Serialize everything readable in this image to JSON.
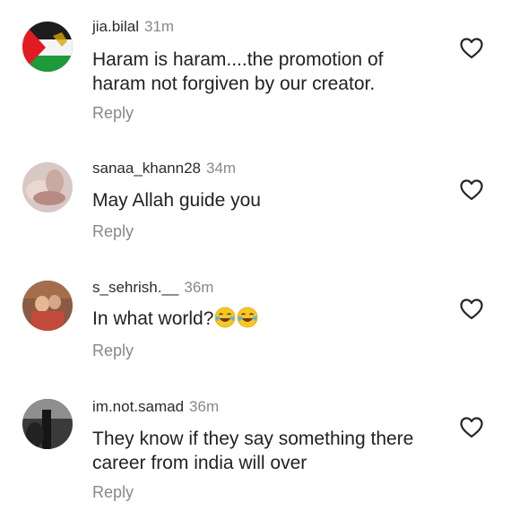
{
  "comments": [
    {
      "username": "jia.bilal",
      "time": "31m",
      "text_lines": [
        "Haram is haram....the promotion of",
        "haram not forgiven by our creator."
      ],
      "reply_label": "Reply",
      "avatar_icon": "palestine-flag-avatar"
    },
    {
      "username": "sanaa_khann28",
      "time": "34m",
      "text_lines": [
        "May Allah guide you"
      ],
      "reply_label": "Reply",
      "avatar_icon": "hands-photo-avatar"
    },
    {
      "username": "s_sehrish.__",
      "time": "36m",
      "text_lines": [
        "In what world?"
      ],
      "emoji": [
        "face-with-tears-of-joy",
        "face-with-tears-of-joy"
      ],
      "reply_label": "Reply",
      "avatar_icon": "couple-photo-avatar"
    },
    {
      "username": "im.not.samad",
      "time": "36m",
      "text_lines": [
        "They know if they say something there",
        "career from india will over"
      ],
      "reply_label": "Reply",
      "avatar_icon": "dark-figure-avatar"
    }
  ],
  "icons": {
    "like": "heart-outline-icon"
  },
  "colors": {
    "text": "#222222",
    "muted": "#888888",
    "heart_stroke": "#262626"
  }
}
